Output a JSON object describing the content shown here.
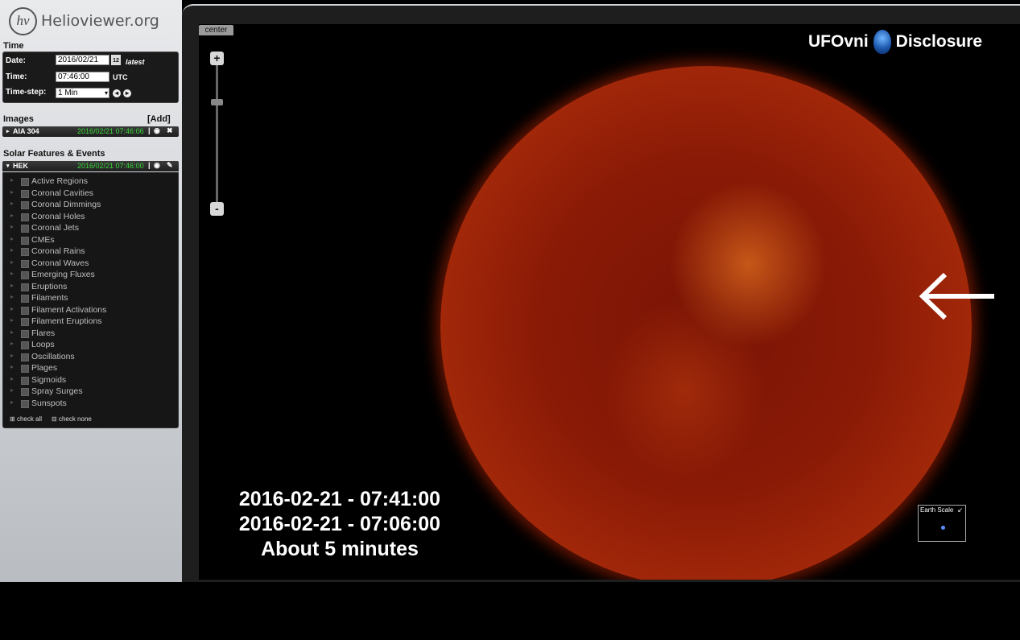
{
  "app": {
    "logo_mark": "hv",
    "name": "Helioviewer.org"
  },
  "time_panel": {
    "title": "Time",
    "date_label": "Date:",
    "date_value": "2016/02/21",
    "calendar_icon_text": "12",
    "latest_link": "latest",
    "time_label": "Time:",
    "time_value": "07:46:00",
    "time_unit": "UTC",
    "timestep_label": "Time-step:",
    "timestep_value": "1 Min"
  },
  "images_panel": {
    "title": "Images",
    "add_link": "[Add]",
    "layers": [
      {
        "name": "AIA 304",
        "time": "2016/02/21 07:46:06"
      }
    ]
  },
  "events_panel": {
    "title": "Solar Features & Events",
    "source": {
      "name": "HEK",
      "time": "2016/02/21 07:46:00"
    },
    "items": [
      "Active Regions",
      "Coronal Cavities",
      "Coronal Dimmings",
      "Coronal Holes",
      "Coronal Jets",
      "CMEs",
      "Coronal Rains",
      "Coronal Waves",
      "Emerging Fluxes",
      "Eruptions",
      "Filaments",
      "Filament Activations",
      "Filament Eruptions",
      "Flares",
      "Loops",
      "Oscillations",
      "Plages",
      "Sigmoids",
      "Spray Surges",
      "Sunspots"
    ],
    "check_all": "check all",
    "check_none": "check none"
  },
  "viewport": {
    "center_button": "center",
    "zoom_in": "+",
    "zoom_out": "-",
    "watermark_left": "UFOvni",
    "watermark_right": "Disclosure",
    "overlay_lines": [
      "2016-02-21 - 07:41:00",
      "2016-02-21 - 07:06:00",
      "About 5 minutes"
    ],
    "earth_scale_label": "Earth Scale"
  },
  "colors": {
    "accent_time": "#39d839",
    "sun": "#a82b0a"
  }
}
